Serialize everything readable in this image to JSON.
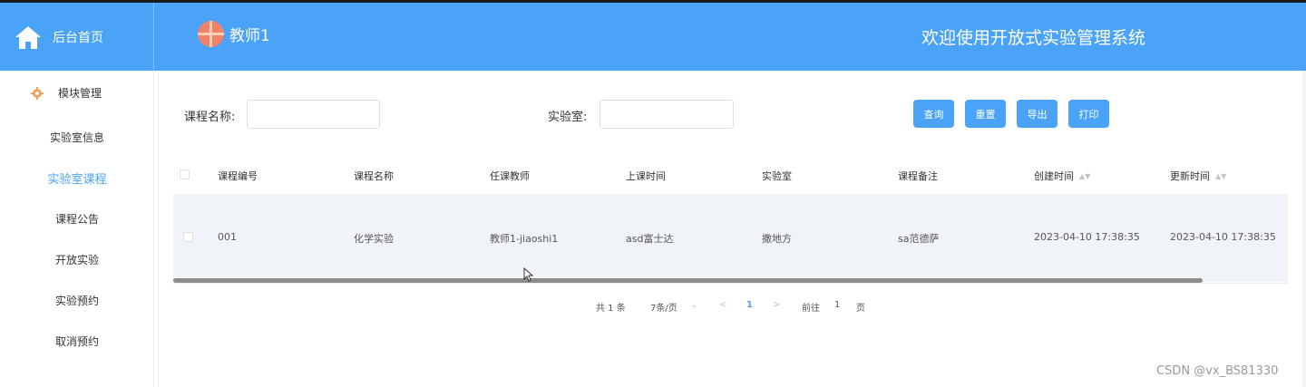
{
  "header": {
    "brand": "后台首页",
    "user": "教师1",
    "welcome": "欢迎使用开放式实验管理系统",
    "color": "#4aa3f7"
  },
  "sidebar": {
    "group": "模块管理",
    "items": [
      {
        "label": "实验室信息",
        "active": false
      },
      {
        "label": "实验室课程",
        "active": true
      },
      {
        "label": "课程公告",
        "active": false
      },
      {
        "label": "开放实验",
        "active": false
      },
      {
        "label": "实验预约",
        "active": false
      },
      {
        "label": "取消预约",
        "active": false
      }
    ]
  },
  "search": {
    "course_name_label": "课程名称:",
    "course_name_value": "",
    "lab_label": "实验室:",
    "lab_value": "",
    "buttons": {
      "query": "查询",
      "reset": "重置",
      "export": "导出",
      "print": "打印"
    }
  },
  "table": {
    "headers": [
      "课程编号",
      "课程名称",
      "任课教师",
      "上课时间",
      "实验室",
      "课程备注",
      "创建时间",
      "更新时间"
    ],
    "sortable": [
      false,
      false,
      false,
      false,
      false,
      false,
      true,
      true
    ],
    "rows": [
      [
        "001",
        "化学实验",
        "教师1-jiaoshi1",
        "asd富士达",
        "撒地方",
        "sa范德萨",
        "2023-04-10 17:38:35",
        "2023-04-10 17:38:35"
      ]
    ]
  },
  "pagination": {
    "total": "共 1 条",
    "page_size": "7条/页",
    "current_page": "1",
    "goto_label": "前往",
    "goto_value": "1",
    "page_suffix": "页"
  },
  "watermark": "CSDN @vx_BS81330"
}
